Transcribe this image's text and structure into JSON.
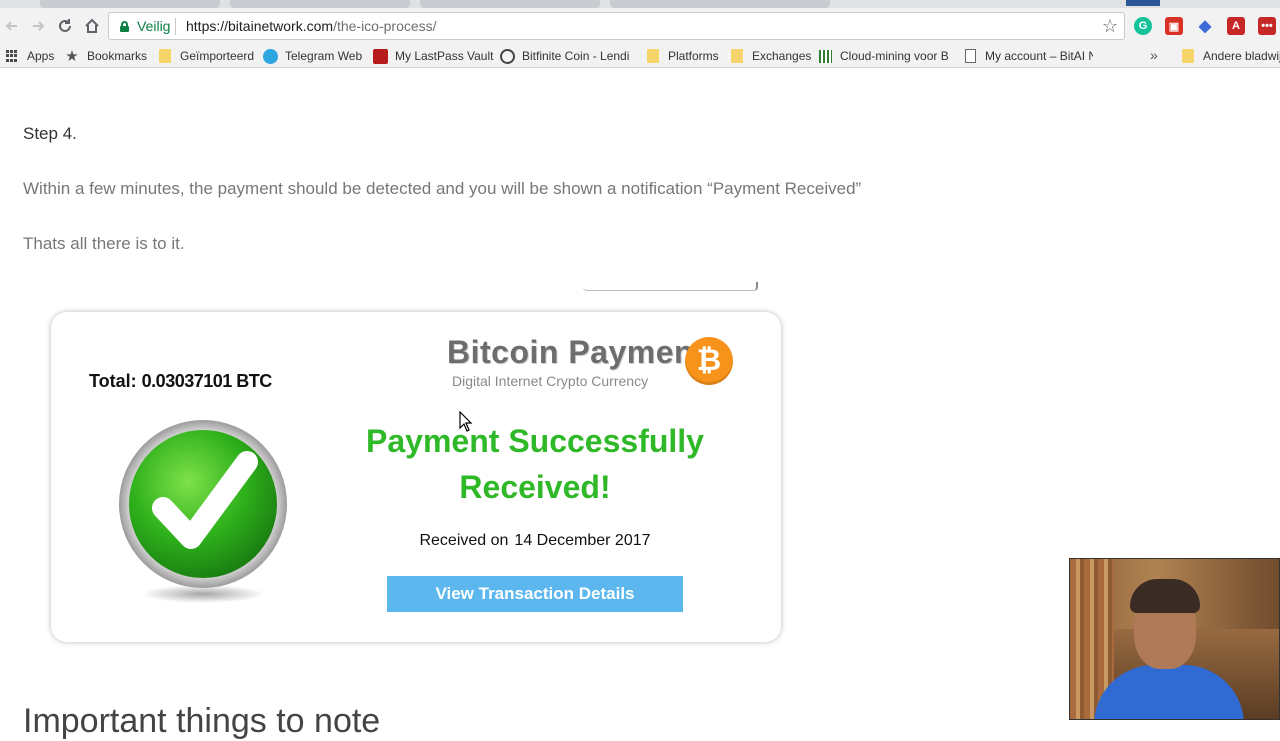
{
  "browser": {
    "security_label": "Veilig",
    "url_host": "https://bitainetwork.com",
    "url_path": "/the-ico-process/",
    "star_icon": "☆"
  },
  "bookmarks": {
    "items": [
      {
        "label": "Apps",
        "icon": "apps-grid-icon"
      },
      {
        "label": "Bookmarks",
        "icon": "star-icon"
      },
      {
        "label": "Geïmporteerd",
        "icon": "folder-icon"
      },
      {
        "label": "Telegram Web",
        "icon": "telegram-icon"
      },
      {
        "label": "My LastPass Vault",
        "icon": "lastpass-icon"
      },
      {
        "label": "Bitfinite Coin - Lendi",
        "icon": "bitfinite-icon"
      },
      {
        "label": "Platforms",
        "icon": "folder-icon"
      },
      {
        "label": "Exchanges",
        "icon": "folder-icon"
      },
      {
        "label": "Cloud-mining voor B",
        "icon": "grid-icon"
      },
      {
        "label": "My account – BitAI N",
        "icon": "page-icon"
      },
      {
        "label": "Andere bladwij",
        "icon": "folder-icon"
      }
    ],
    "overflow": "»"
  },
  "content": {
    "step": "Step 4.",
    "para1": "Within a few minutes, the payment should be detected and you will be shown a notification “Payment Received”",
    "para2": "Thats all there is to it.",
    "heading2": "Important things to note"
  },
  "card": {
    "total_label": "Total:",
    "total_amount": "0.03037101 BTC",
    "brand_title": "Bitcoin Payment",
    "brand_subtitle": "Digital Internet Crypto Currency",
    "btc_symbol": "₿",
    "success_line1": "Payment Successfully",
    "success_line2": "Received!",
    "received_label": "Received on",
    "received_date": "14 December 2017",
    "button_label": "View Transaction Details"
  },
  "colors": {
    "success_green": "#2fb827",
    "button_blue": "#5bb7ee",
    "bitcoin_orange": "#f7931a",
    "secure_green": "#0b8043"
  }
}
